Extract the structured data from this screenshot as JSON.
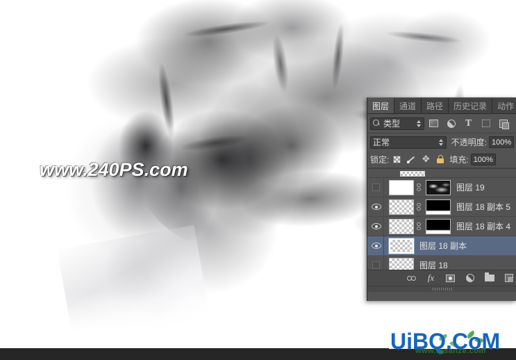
{
  "canvas": {
    "watermark_main": "www.240PS.com",
    "site_watermark": "UiBQ.CoM",
    "site_watermark_sub": "www.ipsanze.com"
  },
  "panel": {
    "tabs": [
      {
        "label": "图层",
        "active": true
      },
      {
        "label": "通道",
        "active": false
      },
      {
        "label": "路径",
        "active": false
      },
      {
        "label": "历史记录",
        "active": false
      },
      {
        "label": "动作",
        "active": false
      }
    ],
    "filter_row": {
      "search_icon": "search-icon",
      "filter_type_label": "类型",
      "icons": [
        "pixel-layer-filter-icon",
        "adjustment-layer-filter-icon",
        "type-layer-filter-icon",
        "shape-layer-filter-icon",
        "smart-object-filter-icon"
      ]
    },
    "blend_row": {
      "mode": "正常",
      "opacity_label": "不透明度:",
      "opacity_value": "100%"
    },
    "lock_row": {
      "lock_label": "锁定:",
      "lock_icons": [
        "lock-transparent-pixels-icon",
        "lock-image-pixels-icon",
        "lock-position-icon",
        "lock-all-icon"
      ],
      "fill_label": "填充:",
      "fill_value": "100%"
    },
    "layers": [
      {
        "name": "图层 19",
        "visible": false,
        "selected": false,
        "thumb": "white",
        "has_link": true,
        "mask": "smoke"
      },
      {
        "name": "图层 18 副本 5",
        "visible": true,
        "selected": false,
        "thumb": "checker",
        "has_link": true,
        "mask": "band"
      },
      {
        "name": "图层 18 副本 4",
        "visible": true,
        "selected": false,
        "thumb": "checker",
        "has_link": true,
        "mask": "band"
      },
      {
        "name": "图层 18 副本",
        "visible": true,
        "selected": true,
        "thumb": "checker",
        "has_link": false,
        "mask": null
      },
      {
        "name": "图层 18",
        "visible": false,
        "selected": false,
        "thumb": "checker",
        "has_link": false,
        "mask": null
      }
    ],
    "toolbar": [
      "link-layers-icon",
      "layer-style-fx-icon",
      "add-layer-mask-icon",
      "new-adjustment-layer-icon",
      "new-group-icon",
      "new-layer-icon"
    ]
  },
  "colors": {
    "panel_bg": "#535353",
    "tab_bar_bg": "#3b3b3b",
    "selected_row": "#5a6a84",
    "field_bg": "#3f3f3f",
    "text": "#e2e2e2",
    "watermark_blue": "#1565c0",
    "watermark_green": "#2e7d32",
    "bottom_band": "#262626"
  }
}
